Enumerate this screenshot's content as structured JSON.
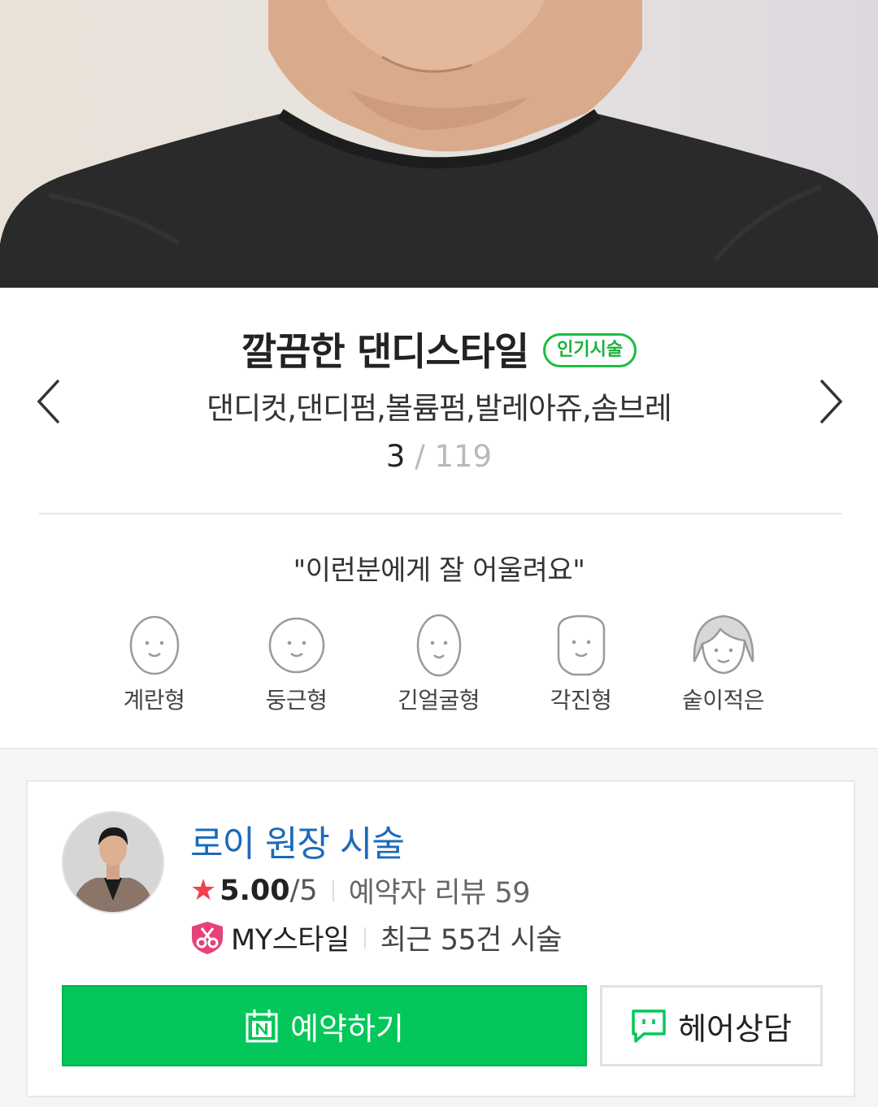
{
  "hero": {
    "image": "hero-photo-man-black-tshirt"
  },
  "style": {
    "title": "깔끔한 댄디스타일",
    "badge": "인기시술",
    "subtitle": "댄디컷,댄디펌,볼륨펌,발레아쥬,솜브레",
    "current_index": "3",
    "separator": " / ",
    "total": "119",
    "prev_icon": "chevron-left-icon",
    "next_icon": "chevron-right-icon"
  },
  "suits": {
    "title": "\"이런분에게 잘 어울려요\"",
    "faces": [
      {
        "label": "계란형",
        "icon": "egg-face-icon"
      },
      {
        "label": "둥근형",
        "icon": "round-face-icon"
      },
      {
        "label": "긴얼굴형",
        "icon": "long-face-icon"
      },
      {
        "label": "각진형",
        "icon": "square-face-icon"
      },
      {
        "label": "숱이적은",
        "icon": "thin-hair-face-icon"
      }
    ]
  },
  "designer": {
    "name": "로이 원장 시술",
    "score": "5.00",
    "score_max": "/5",
    "review_label": "예약자 리뷰 59",
    "my_style_label": "MY스타일",
    "recent_label": "최근 55건 시술",
    "book_label": "예약하기",
    "consult_label": "헤어상담"
  },
  "colors": {
    "accent_green": "#03c75a",
    "badge_green": "#1bbd3f",
    "link_blue": "#1c6bba",
    "star_red": "#f0404c",
    "my_pink": "#e8407a"
  }
}
